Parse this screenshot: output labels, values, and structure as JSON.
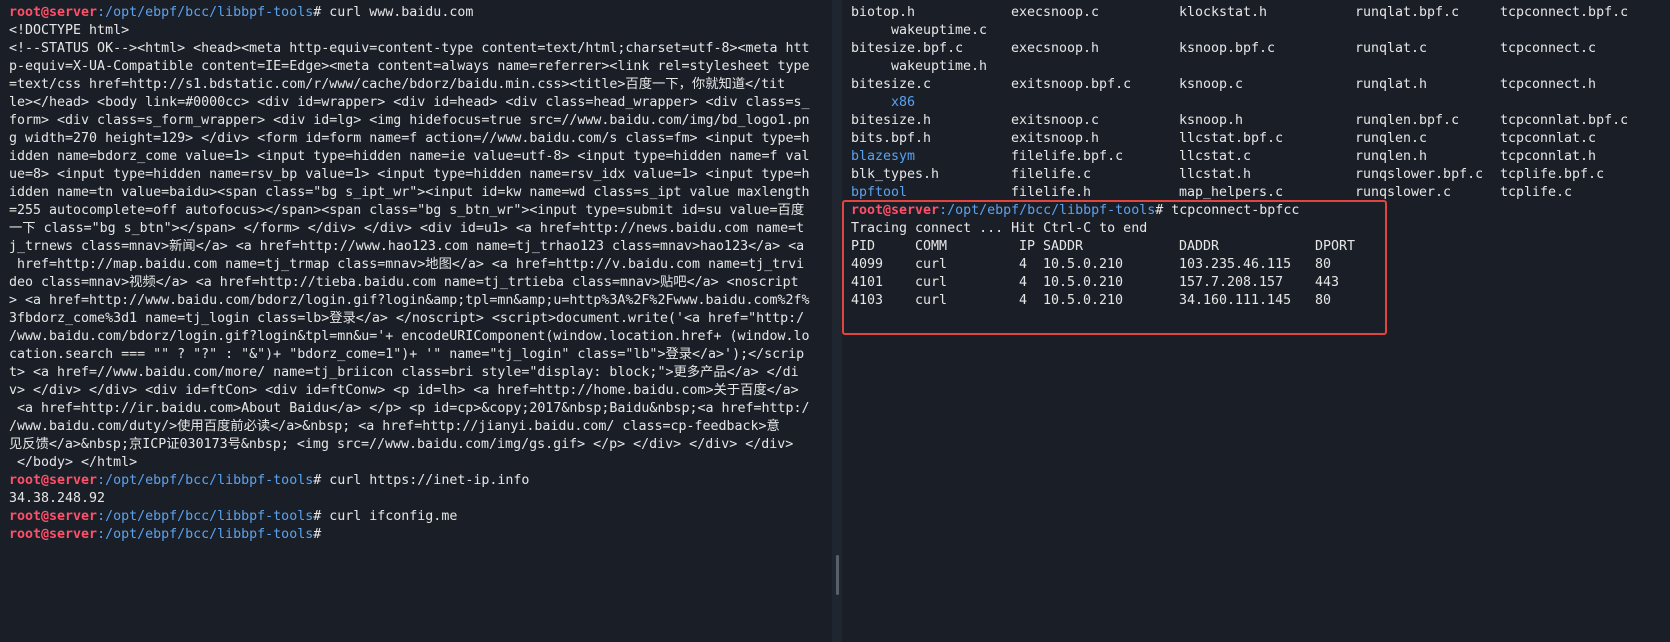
{
  "left": {
    "prompt_user": "root@server",
    "prompt_path": ":/opt/ebpf/bcc/libbpf-tools",
    "prompt_hash": "#",
    "cmd1": " curl www.baidu.com",
    "out1": [
      "<!DOCTYPE html>",
      "<!--STATUS OK--><html> <head><meta http-equiv=content-type content=text/html;charset=utf-8><meta htt",
      "p-equiv=X-UA-Compatible content=IE=Edge><meta content=always name=referrer><link rel=stylesheet type",
      "=text/css href=http://s1.bdstatic.com/r/www/cache/bdorz/baidu.min.css><title>百度一下，你就知道</tit",
      "le></head> <body link=#0000cc> <div id=wrapper> <div id=head> <div class=head_wrapper> <div class=s_",
      "form> <div class=s_form_wrapper> <div id=lg> <img hidefocus=true src=//www.baidu.com/img/bd_logo1.pn",
      "g width=270 height=129> </div> <form id=form name=f action=//www.baidu.com/s class=fm> <input type=h",
      "idden name=bdorz_come value=1> <input type=hidden name=ie value=utf-8> <input type=hidden name=f val",
      "ue=8> <input type=hidden name=rsv_bp value=1> <input type=hidden name=rsv_idx value=1> <input type=h",
      "idden name=tn value=baidu><span class=\"bg s_ipt_wr\"><input id=kw name=wd class=s_ipt value maxlength",
      "=255 autocomplete=off autofocus></span><span class=\"bg s_btn_wr\"><input type=submit id=su value=百度",
      "一下 class=\"bg s_btn\"></span> </form> </div> </div> <div id=u1> <a href=http://news.baidu.com name=t",
      "j_trnews class=mnav>新闻</a> <a href=http://www.hao123.com name=tj_trhao123 class=mnav>hao123</a> <a",
      " href=http://map.baidu.com name=tj_trmap class=mnav>地图</a> <a href=http://v.baidu.com name=tj_trvi",
      "deo class=mnav>视频</a> <a href=http://tieba.baidu.com name=tj_trtieba class=mnav>贴吧</a> <noscript",
      "> <a href=http://www.baidu.com/bdorz/login.gif?login&amp;tpl=mn&amp;u=http%3A%2F%2Fwww.baidu.com%2f%",
      "3fbdorz_come%3d1 name=tj_login class=lb>登录</a> </noscript> <script>document.write('<a href=\"http:/",
      "/www.baidu.com/bdorz/login.gif?login&tpl=mn&u='+ encodeURIComponent(window.location.href+ (window.lo",
      "cation.search === \"\" ? \"?\" : \"&\")+ \"bdorz_come=1\")+ '\" name=\"tj_login\" class=\"lb\">登录</a>');</scrip",
      "t> <a href=//www.baidu.com/more/ name=tj_briicon class=bri style=\"display: block;\">更多产品</a> </di",
      "v> </div> </div> <div id=ftCon> <div id=ftConw> <p id=lh> <a href=http://home.baidu.com>关于百度</a>",
      " <a href=http://ir.baidu.com>About Baidu</a> </p> <p id=cp>&copy;2017&nbsp;Baidu&nbsp;<a href=http:/",
      "/www.baidu.com/duty/>使用百度前必读</a>&nbsp; <a href=http://jianyi.baidu.com/ class=cp-feedback>意",
      "见反馈</a>&nbsp;京ICP证030173号&nbsp; <img src=//www.baidu.com/img/gs.gif> </p> </div> </div> </div>",
      " </body> </html>"
    ],
    "cmd2": " curl https://inet-ip.info",
    "out2": "34.38.248.92",
    "cmd3": " curl ifconfig.me",
    "cmd4": ""
  },
  "right": {
    "ls": [
      [
        "biotop.h",
        "execsnoop.c",
        "klockstat.h",
        "runqlat.bpf.c",
        "tcpconnect.bpf.c"
      ],
      [
        "",
        "wakeuptime.c",
        "",
        "",
        ""
      ],
      [
        "bitesize.bpf.c",
        "execsnoop.h",
        "ksnoop.bpf.c",
        "runqlat.c",
        "tcpconnect.c"
      ],
      [
        "",
        "wakeuptime.h",
        "",
        "",
        ""
      ],
      [
        "bitesize.c",
        "exitsnoop.bpf.c",
        "ksnoop.c",
        "runqlat.h",
        "tcpconnect.h"
      ],
      [
        "",
        "x86",
        "",
        "",
        ""
      ],
      [
        "bitesize.h",
        "exitsnoop.c",
        "ksnoop.h",
        "runqlen.bpf.c",
        "tcpconnlat.bpf.c"
      ],
      [
        "bits.bpf.h",
        "exitsnoop.h",
        "llcstat.bpf.c",
        "runqlen.c",
        "tcpconnlat.c"
      ],
      [
        "blazesym",
        "filelife.bpf.c",
        "llcstat.c",
        "runqlen.h",
        "tcpconnlat.h"
      ],
      [
        "blk_types.h",
        "filelife.c",
        "llcstat.h",
        "runqslower.bpf.c",
        "tcplife.bpf.c"
      ],
      [
        "bpftool",
        "filelife.h",
        "map_helpers.c",
        "runqslower.c",
        "tcplife.c"
      ]
    ],
    "dirs": [
      "blazesym",
      "bpftool",
      "x86"
    ],
    "prompt_user": "root@server",
    "prompt_path": ":/opt/ebpf/bcc/libbpf-tools",
    "prompt_hash": "#",
    "cmd": " tcpconnect-bpfcc",
    "tracing": "Tracing connect ... Hit Ctrl-C to end",
    "headers": [
      "PID",
      "COMM",
      "IP",
      "SADDR",
      "DADDR",
      "DPORT"
    ],
    "rows": [
      [
        "4099",
        "curl",
        "4",
        "10.5.0.210",
        "103.235.46.115",
        "80"
      ],
      [
        "4101",
        "curl",
        "4",
        "10.5.0.210",
        "157.7.208.157",
        "443"
      ],
      [
        "4103",
        "curl",
        "4",
        "10.5.0.210",
        "34.160.111.145",
        "80"
      ]
    ],
    "highlight_color": "#e2453f"
  }
}
